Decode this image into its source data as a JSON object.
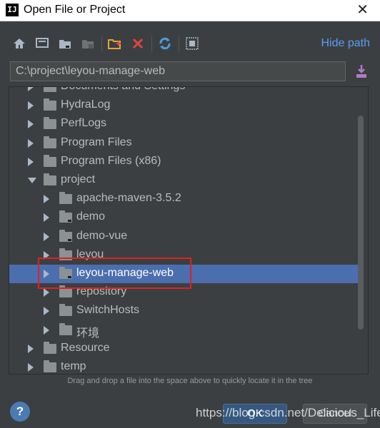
{
  "window": {
    "title": "Open File or Project",
    "close_glyph": "✕"
  },
  "toolbar": {
    "buttons": [
      {
        "icon": "home-icon"
      },
      {
        "icon": "desktop-icon"
      },
      {
        "icon": "project-folder-icon"
      },
      {
        "icon": "module-folder-icon"
      },
      {
        "icon": "new-folder-icon"
      },
      {
        "icon": "delete-icon"
      },
      {
        "icon": "refresh-icon"
      },
      {
        "icon": "show-hidden-icon"
      }
    ],
    "hide_path_label": "Hide path"
  },
  "path": {
    "value": "C:\\project\\leyou-manage-web"
  },
  "tree": {
    "rows": [
      {
        "label": "Documents and Settings",
        "state": "collapsed",
        "depth": 0
      },
      {
        "label": "HydraLog",
        "state": "collapsed",
        "depth": 0
      },
      {
        "label": "PerfLogs",
        "state": "collapsed",
        "depth": 0
      },
      {
        "label": "Program Files",
        "state": "collapsed",
        "depth": 0
      },
      {
        "label": "Program Files (x86)",
        "state": "collapsed",
        "depth": 0
      },
      {
        "label": "project",
        "state": "expanded",
        "depth": 0
      },
      {
        "label": "apache-maven-3.5.2",
        "state": "collapsed",
        "depth": 1
      },
      {
        "label": "demo",
        "state": "collapsed",
        "depth": 1
      },
      {
        "label": "demo-vue",
        "state": "collapsed",
        "depth": 1
      },
      {
        "label": "leyou",
        "state": "collapsed",
        "depth": 1
      },
      {
        "label": "leyou-manage-web",
        "state": "collapsed",
        "depth": 1,
        "selected": true
      },
      {
        "label": "repository",
        "state": "collapsed",
        "depth": 1
      },
      {
        "label": "SwitchHosts",
        "state": "collapsed",
        "depth": 1
      },
      {
        "label": "环境",
        "state": "collapsed",
        "depth": 1
      },
      {
        "label": "Resource",
        "state": "collapsed",
        "depth": 0
      },
      {
        "label": "temp",
        "state": "collapsed",
        "depth": 0
      }
    ]
  },
  "hint": "Drag and drop a file into the space above to quickly locate it in the tree",
  "footer": {
    "help_label": "?",
    "ok_label": "OK",
    "cancel_label": "Cancel",
    "watermark": "https://blog.csdn.net/Delicious_Life"
  },
  "colors": {
    "selection": "#4b6eaf",
    "link": "#589df6",
    "highlight": "#e02020"
  }
}
